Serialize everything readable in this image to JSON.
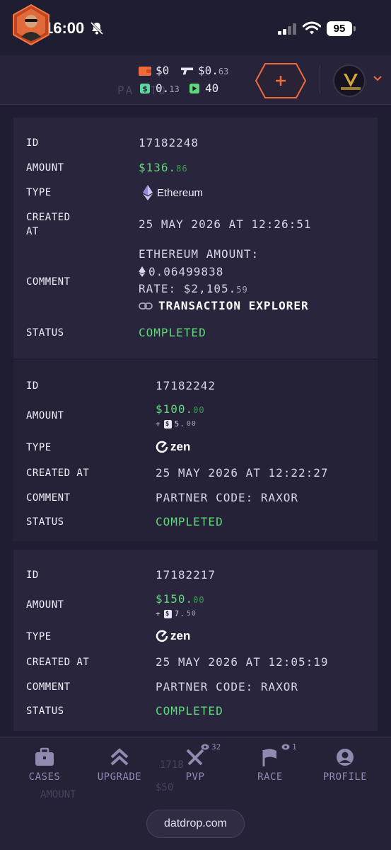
{
  "status_bar": {
    "time": "16:00",
    "battery": "95"
  },
  "header": {
    "balances": {
      "wallet_main": "$0",
      "gun_main": "$0.",
      "gun_cents": "63",
      "coin_main": "0.",
      "coin_cents": "13",
      "tickets": "40"
    },
    "ghost_title": "PA         STO"
  },
  "transactions": [
    {
      "id_label": "ID",
      "id": "17182248",
      "amount_label": "AMOUNT",
      "amount_main": "$136.",
      "amount_cents": "86",
      "type_label": "TYPE",
      "type": "Ethereum",
      "type_icon": "ethereum-icon",
      "created_label_1": "CREATED",
      "created_label_2": "AT",
      "created_at": "25 MAY 2026 AT 12:26:51",
      "comment_label": "COMMENT",
      "comment_line1": "ETHEREUM AMOUNT:",
      "comment_eth": "0.06499838",
      "comment_rate_main": "RATE: $2,105.",
      "comment_rate_cents": "59",
      "comment_link": "TRANSACTION EXPLORER",
      "status_label": "STATUS",
      "status": "COMPLETED"
    },
    {
      "id_label": "ID",
      "id": "17182242",
      "amount_label": "AMOUNT",
      "amount_main": "$100.",
      "amount_cents": "00",
      "bonus_main": "5.",
      "bonus_cents": "00",
      "type_label": "TYPE",
      "type": "zen",
      "type_icon": "zen-logo-icon",
      "created_label": "CREATED AT",
      "created_at": "25 MAY 2026 AT 12:22:27",
      "comment_label": "COMMENT",
      "comment": "PARTNER CODE: RAXOR",
      "status_label": "STATUS",
      "status": "COMPLETED"
    },
    {
      "id_label": "ID",
      "id": "17182217",
      "amount_label": "AMOUNT",
      "amount_main": "$150.",
      "amount_cents": "00",
      "bonus_main": "7.",
      "bonus_cents": "50",
      "type_label": "TYPE",
      "type": "zen",
      "type_icon": "zen-logo-icon",
      "created_label": "CREATED AT",
      "created_at": "25 MAY 2026 AT 12:05:19",
      "comment_label": "COMMENT",
      "comment": "PARTNER CODE: RAXOR",
      "status_label": "STATUS",
      "status": "COMPLETED"
    }
  ],
  "ghost_next": {
    "id": "1718",
    "amount_label": "AMOUNT",
    "amount": "$50"
  },
  "bottom_nav": {
    "items": [
      {
        "label": "CASES",
        "icon": "briefcase-icon"
      },
      {
        "label": "UPGRADE",
        "icon": "double-chevron-up-icon"
      },
      {
        "label": "PVP",
        "icon": "crossed-swords-icon",
        "viewers": "32"
      },
      {
        "label": "RACE",
        "icon": "flag-icon",
        "viewers": "1"
      },
      {
        "label": "PROFILE",
        "icon": "user-icon"
      }
    ],
    "url": "datdrop.com"
  },
  "colors": {
    "background": "#1f1d31",
    "card": "#28253c",
    "green": "#5fd77a",
    "accent_orange": "#f06a3c",
    "nav_text": "#8f8bb0"
  }
}
